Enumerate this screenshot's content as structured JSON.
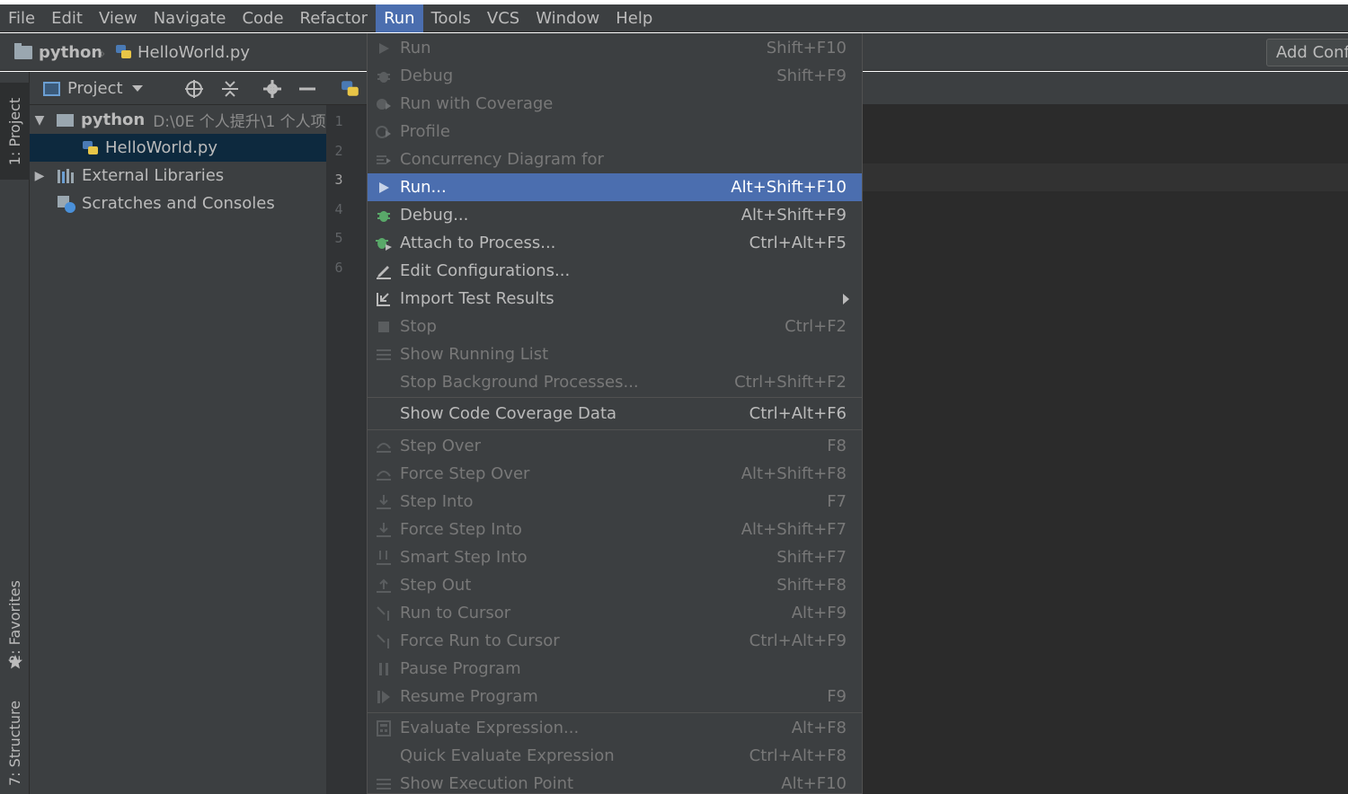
{
  "menubar": {
    "items": [
      "File",
      "Edit",
      "View",
      "Navigate",
      "Code",
      "Refactor",
      "Run",
      "Tools",
      "VCS",
      "Window",
      "Help"
    ],
    "active": "Run"
  },
  "navbar": {
    "project_name": "python",
    "file_name": "HelloWorld.py",
    "add_config_label": "Add Configuration..."
  },
  "left_strip": {
    "project_tab": "1: Project",
    "favorites_tab": "2: Favorites",
    "structure_tab": "7: Structure"
  },
  "project_panel": {
    "view_label": "Project",
    "tree": [
      {
        "label": "python",
        "path": "D:\\0E 个人提升\\1 个人项",
        "expanded": true
      },
      {
        "label": "HelloWorld.py",
        "selected": true
      },
      {
        "label": "External Libraries",
        "expanded": false
      },
      {
        "label": "Scratches and Consoles"
      }
    ]
  },
  "editor": {
    "line_numbers": [
      "1",
      "2",
      "3",
      "4",
      "5",
      "6"
    ]
  },
  "run_menu": {
    "items": [
      {
        "label": "Run",
        "shortcut": "Shift+F10",
        "enabled": false,
        "icon": "play-icon"
      },
      {
        "label": "Debug",
        "shortcut": "Shift+F9",
        "enabled": false,
        "icon": "bug-icon"
      },
      {
        "label": "Run with Coverage",
        "shortcut": "",
        "enabled": false,
        "icon": "coverage-icon"
      },
      {
        "label": "Profile",
        "shortcut": "",
        "enabled": false,
        "icon": "profile-icon"
      },
      {
        "label": "Concurrency Diagram for",
        "shortcut": "",
        "enabled": false,
        "icon": "concurrency-icon"
      },
      {
        "label": "Run...",
        "shortcut": "Alt+Shift+F10",
        "enabled": true,
        "highlighted": true,
        "icon": "play-icon"
      },
      {
        "label": "Debug...",
        "shortcut": "Alt+Shift+F9",
        "enabled": true,
        "icon": "bug-icon"
      },
      {
        "label": "Attach to Process...",
        "shortcut": "Ctrl+Alt+F5",
        "enabled": true,
        "icon": "attach-icon"
      },
      {
        "label": "Edit Configurations...",
        "shortcut": "",
        "enabled": true,
        "icon": "pencil-icon"
      },
      {
        "label": "Import Test Results",
        "shortcut": "",
        "enabled": true,
        "submenu": true,
        "icon": "import-icon"
      },
      {
        "label": "Stop",
        "shortcut": "Ctrl+F2",
        "enabled": false,
        "icon": "stop-icon"
      },
      {
        "label": "Show Running List",
        "shortcut": "",
        "enabled": false,
        "icon": "list-icon"
      },
      {
        "label": "Stop Background Processes...",
        "shortcut": "Ctrl+Shift+F2",
        "enabled": false,
        "icon": ""
      },
      {
        "label": "Show Code Coverage Data",
        "shortcut": "Ctrl+Alt+F6",
        "enabled": true,
        "icon": ""
      },
      {
        "label": "Step Over",
        "shortcut": "F8",
        "enabled": false,
        "icon": "step-over-icon"
      },
      {
        "label": "Force Step Over",
        "shortcut": "Alt+Shift+F8",
        "enabled": false,
        "icon": "force-step-over-icon"
      },
      {
        "label": "Step Into",
        "shortcut": "F7",
        "enabled": false,
        "icon": "step-into-icon"
      },
      {
        "label": "Force Step Into",
        "shortcut": "Alt+Shift+F7",
        "enabled": false,
        "icon": "force-step-into-icon"
      },
      {
        "label": "Smart Step Into",
        "shortcut": "Shift+F7",
        "enabled": false,
        "icon": "smart-step-into-icon"
      },
      {
        "label": "Step Out",
        "shortcut": "Shift+F8",
        "enabled": false,
        "icon": "step-out-icon"
      },
      {
        "label": "Run to Cursor",
        "shortcut": "Alt+F9",
        "enabled": false,
        "icon": "run-to-cursor-icon"
      },
      {
        "label": "Force Run to Cursor",
        "shortcut": "Ctrl+Alt+F9",
        "enabled": false,
        "icon": "force-run-to-cursor-icon"
      },
      {
        "label": "Pause Program",
        "shortcut": "",
        "enabled": false,
        "icon": "pause-icon"
      },
      {
        "label": "Resume Program",
        "shortcut": "F9",
        "enabled": false,
        "icon": "resume-icon"
      },
      {
        "label": "Evaluate Expression...",
        "shortcut": "Alt+F8",
        "enabled": false,
        "icon": "calculator-icon"
      },
      {
        "label": "Quick Evaluate Expression",
        "shortcut": "Ctrl+Alt+F8",
        "enabled": false,
        "icon": ""
      },
      {
        "label": "Show Execution Point",
        "shortcut": "Alt+F10",
        "enabled": false,
        "icon": "execution-point-icon"
      }
    ]
  },
  "colors": {
    "menu_bg": "#3c3f41",
    "highlight": "#4b6eaf",
    "editor_bg": "#2b2b2b",
    "disabled_text": "#787878",
    "text": "#bbbbbb"
  }
}
